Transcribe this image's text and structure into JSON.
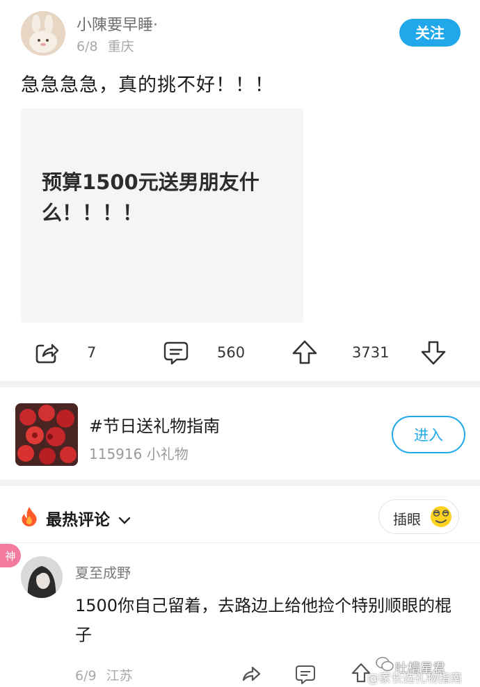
{
  "post": {
    "username": "小陳要早睡·",
    "date": "6/8",
    "location": "重庆",
    "follow_label": "关注",
    "text": "急急急急，真的挑不好！！！",
    "image_text": "预算1500元送男朋友什么！！！！",
    "actions": {
      "share_count": "7",
      "comment_count": "560",
      "like_count": "3731"
    }
  },
  "topic": {
    "title": "#节日送礼物指南",
    "subtitle": "115916 小礼物",
    "enter_label": "进入"
  },
  "comments_header": {
    "sort_label": "最热评论",
    "insert_label": "插眼"
  },
  "comment": {
    "badge": "神",
    "username": "夏至成野",
    "text": "1500你自己留着，去路边上给他捡个特别顺眼的棍子",
    "date": "6/9",
    "location": "江苏"
  },
  "watermark": {
    "line1": "吐槽星君",
    "line2": "@家长选礼物指南"
  },
  "colors": {
    "accent": "#21a8ea",
    "badge": "#f47ba0",
    "fire": "#ff5a2a"
  }
}
